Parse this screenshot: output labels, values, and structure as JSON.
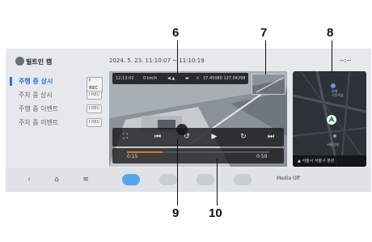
{
  "header": {
    "title": "빌트인 캠",
    "date_range": "2024. 5. 23.  11:10:07 ~ 11:10:19",
    "clock": "--:--"
  },
  "sidebar": {
    "items": [
      {
        "label": "주행 중 상시",
        "badge": "I REC",
        "active": true
      },
      {
        "label": "주차 중 상시",
        "badge": "I REC",
        "active": false
      },
      {
        "label": "주행 중 이벤트",
        "badge": "I REC",
        "active": false
      },
      {
        "label": "주차 중 이벤트",
        "badge": "I REC",
        "active": false
      }
    ]
  },
  "video_info": {
    "time": "12:13:02",
    "speed": "0 km/h",
    "coords": "37.45080 127.04298"
  },
  "player": {
    "current_time": "0:15",
    "total_time": "0:59",
    "progress_fraction": 0.25
  },
  "map": {
    "address": "서울시 서울구 분관",
    "labels": [
      "양재",
      "시민의숲",
      "서울양재"
    ]
  },
  "navbar": {
    "media_label": "Media Off"
  },
  "callouts": [
    "6",
    "7",
    "8",
    "9",
    "10"
  ],
  "colors": {
    "accent": "#2f6fd6",
    "progress": "#d8762b",
    "active_tab": "#55a6e8"
  },
  "icons": {
    "back": "‹",
    "home": "⌂",
    "menu": "≡",
    "fullscreen": "⛶",
    "prev": "⏮",
    "rewind": "↺",
    "play": "▶",
    "forward": "↻",
    "next": "⏭"
  }
}
